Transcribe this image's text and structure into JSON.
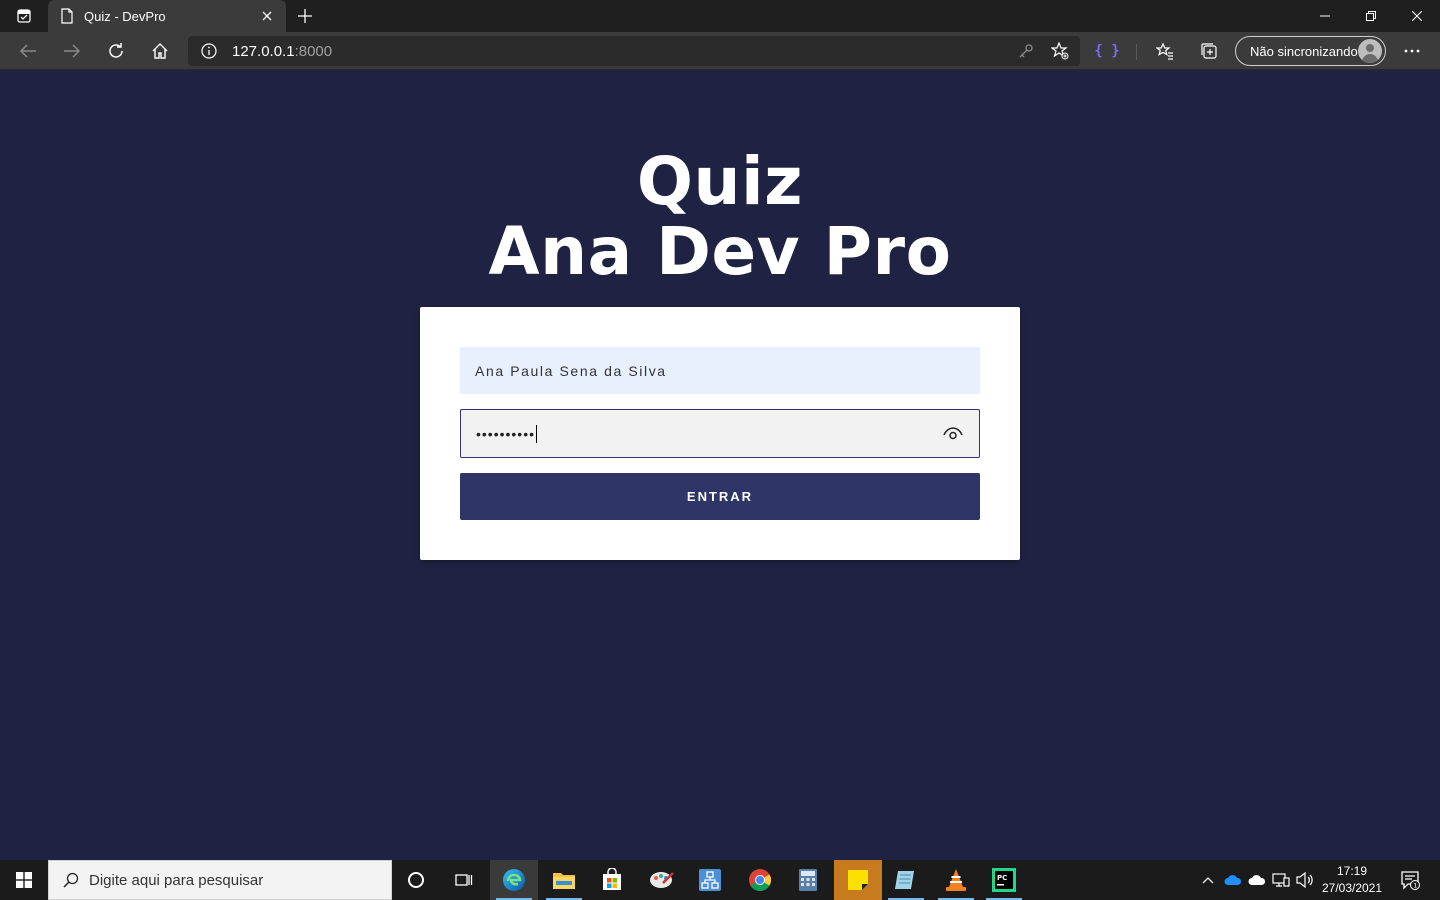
{
  "browser": {
    "tab_title": "Quiz - DevPro",
    "url_host": "127.0.0.1",
    "url_port": ":8000",
    "profile_label": "Não sincronizando",
    "extension_label": "{ }"
  },
  "page": {
    "heading_line1": "Quiz",
    "heading_line2": "Ana Dev Pro",
    "username_value": "Ana Paula Sena da Silva",
    "password_mask": "••••••••••",
    "submit_label": "ENTRAR"
  },
  "taskbar": {
    "search_placeholder": "Digite aqui para pesquisar",
    "time": "17:19",
    "date": "27/03/2021",
    "notification_count": "1"
  },
  "colors": {
    "background": "#1f2243",
    "button": "#2f3566",
    "autofill": "#e8f0fe"
  }
}
